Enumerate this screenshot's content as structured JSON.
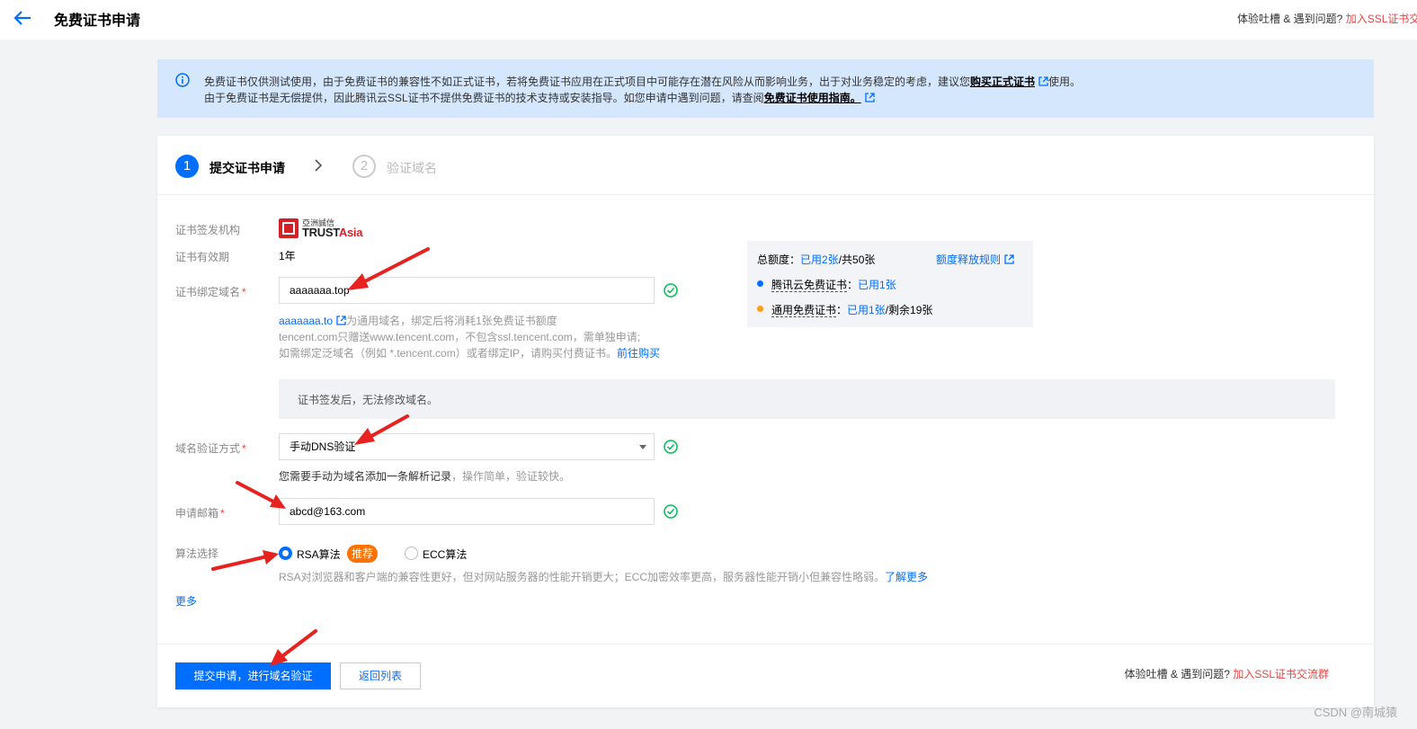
{
  "header": {
    "title": "免费证书申请",
    "feedback_text": "体验吐槽 & 遇到问题?",
    "feedback_link": "加入SSL证书交流群"
  },
  "notice": {
    "line1_prefix": "免费证书仅供测试使用，由于免费证书的兼容性不如正式证书，若将免费证书应用在正式项目中可能存在潜在风险从而影响业务，出于对业务稳定的考虑，建议您",
    "line1_link": "购买正式证书",
    "line1_suffix": "使用。",
    "line2_prefix": "由于免费证书是无偿提供，因此腾讯云SSL证书不提供免费证书的技术支持或安装指导。如您申请中遇到问题，请查阅",
    "line2_link": "免费证书使用指南。"
  },
  "steps": [
    {
      "num": "1",
      "label": "提交证书申请"
    },
    {
      "num": "2",
      "label": "验证域名"
    }
  ],
  "form": {
    "issuer_label": "证书签发机构",
    "issuer_logo_cn": "亞洲誠信",
    "issuer_logo_en_1": "TRUST",
    "issuer_logo_en_2": "Asia",
    "validity_label": "证书有效期",
    "validity_value": "1年",
    "domain_label": "证书绑定域名",
    "domain_value": "aaaaaaa.top",
    "domain_hint_link": "aaaaaaa.to",
    "domain_hint_1": "为通用域名，绑定后将消耗1张免费证书额度",
    "domain_hint_2": "tencent.com只赠送www.tencent.com，不包含ssl.tencent.com，需单独申请;",
    "domain_hint_3": "如需绑定泛域名（例如 *.tencent.com）或者绑定IP，请购买付费证书。",
    "domain_hint_3_link": "前往购买",
    "tip": "证书签发后，无法修改域名。",
    "verify_label": "域名验证方式",
    "verify_value": "手动DNS验证",
    "verify_hint_bold": "您需要手动为域名添加一条解析记录",
    "verify_hint_rest": "，操作简单，验证较快。",
    "email_label": "申请邮箱",
    "email_value": "abcd@163.com",
    "algo_label": "算法选择",
    "algo_rsa": "RSA算法",
    "algo_badge": "推荐",
    "algo_ecc": "ECC算法",
    "algo_hint": "RSA对浏览器和客户端的兼容性更好，但对网站服务器的性能开销更大；ECC加密效率更高，服务器性能开销小但兼容性略弱。",
    "algo_hint_link": "了解更多",
    "more": "更多"
  },
  "quota": {
    "title_prefix": "总额度：",
    "title_used": "已用2张",
    "title_suffix": "/共50张",
    "rule_link": "额度释放规则",
    "item1_label": "腾讯云免费证书",
    "item1_colon": "：",
    "item1_used": "已用1张",
    "item2_label": "通用免费证书",
    "item2_colon": "：",
    "item2_used": "已用1张",
    "item2_rest": "/剩余19张",
    "dot1_color": "#006eff",
    "dot2_color": "#ff9c19"
  },
  "footer": {
    "submit": "提交申请，进行域名验证",
    "back": "返回列表",
    "feedback_text": "体验吐槽 & 遇到问题?",
    "feedback_link": "加入SSL证书交流群"
  },
  "watermark": "CSDN @南城猿"
}
